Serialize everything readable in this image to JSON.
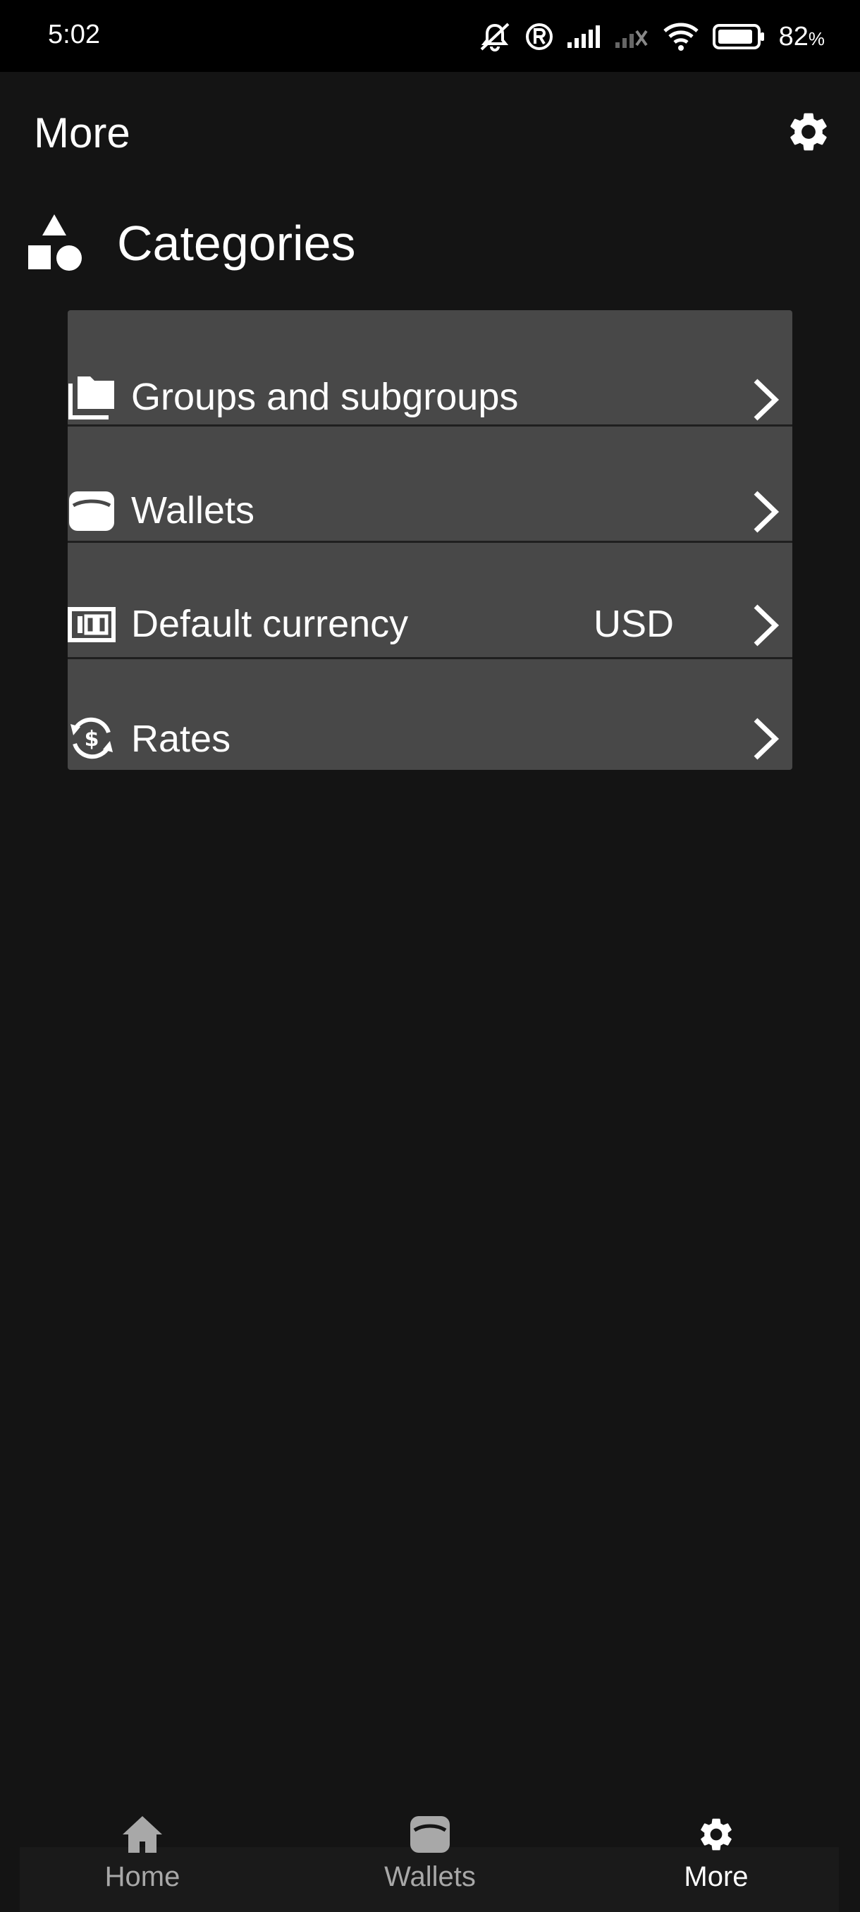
{
  "status_bar": {
    "time": "5:02",
    "battery": "82",
    "battery_unit": "%"
  },
  "app_bar": {
    "title": "More"
  },
  "section": {
    "title": "Categories"
  },
  "menu": [
    {
      "icon": "folders-icon",
      "label": "Groups and subgroups",
      "value": ""
    },
    {
      "icon": "wallet-icon",
      "label": "Wallets",
      "value": ""
    },
    {
      "icon": "banknote-icon",
      "label": "Default currency",
      "value": "USD"
    },
    {
      "icon": "currency-exchange-icon",
      "label": "Rates",
      "value": ""
    }
  ],
  "bottom_nav": [
    {
      "icon": "home-icon",
      "label": "Home",
      "active": false
    },
    {
      "icon": "wallet-icon",
      "label": "Wallets",
      "active": false
    },
    {
      "icon": "gear-icon",
      "label": "More",
      "active": true
    }
  ],
  "colors": {
    "background": "#141414",
    "card": "#484848",
    "active_nav": "#ffffff",
    "inactive_nav": "#a8a8a8"
  }
}
